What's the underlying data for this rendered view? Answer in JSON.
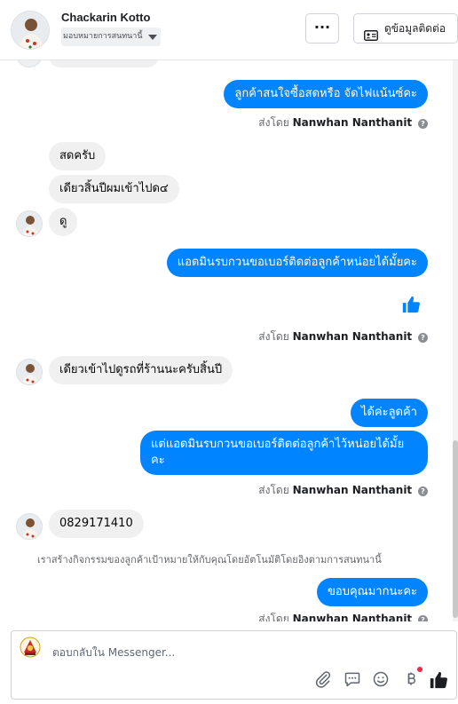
{
  "header": {
    "contact_name": "Chackarin Kotto",
    "assign_label": "มอบหมายการสนทนานี้",
    "more_label": "···",
    "view_contact_label": "ดูข้อมูลติดต่อ"
  },
  "messages": {
    "m1": "ลูกค้าสนใจซื้อสดหรือ จัดไฟแน้นซ์คะ",
    "m2": "สดครับ",
    "m3": "เดียวสิ้นปีผมเข้าไปด๔",
    "m4": "ดู",
    "m5": "แอดมินรบกวนขอเบอร์ติดต่อลูกค้าหน่อยได้มั้ยคะ",
    "m6": "เดียวเข้าไปดูรถที่ร้านนะครับสิ้นปี",
    "m7": "ได้ค่ะลูดค้า",
    "m8_line1": "แต่แอดมินรบกวนขอเบอร์ติดต่อลูกค้าไว้หน่อยได้มั้ย",
    "m8_line2": "คะ",
    "m9": "0829171410",
    "m10": "ขอบคุณมากนะคะ"
  },
  "sent_by": {
    "prefix": "ส่งโดย",
    "agent": "Nanwhan Nanthanit",
    "info_glyph": "?"
  },
  "system_note": "เราสร้างกิจกรรมของลูกค้าเป้าหมายให้กับคุณโดยอัตโนมัติโดยอิงตามการสนทนานี้",
  "composer": {
    "placeholder": "ตอบกลับใน Messenger...",
    "tools": [
      "attach-icon",
      "saved-reply-icon",
      "emoji-icon",
      "baht-payment-icon",
      "like-icon"
    ]
  },
  "colors": {
    "outgoing_bubble": "#0084ff",
    "incoming_bubble": "#f0f0f0",
    "like": "#0084ff",
    "notification_dot": "#f02849"
  }
}
